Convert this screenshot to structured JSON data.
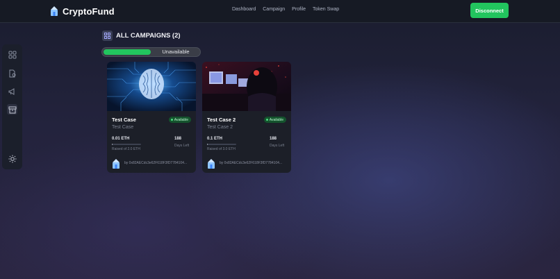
{
  "header": {
    "brand": "CryptoFund",
    "nav": [
      "Dashboard",
      "Campaign",
      "Profile",
      "Token Swap"
    ],
    "disconnect_label": "Disconnect",
    "accent_color": "#22c55e"
  },
  "sidebar": {
    "items": [
      {
        "icon": "grid-icon"
      },
      {
        "icon": "document-icon"
      },
      {
        "icon": "megaphone-icon"
      },
      {
        "icon": "archive-icon"
      },
      {
        "icon": "sun-icon"
      }
    ]
  },
  "main": {
    "title": "ALL CAMPAIGNS (2)",
    "toggle": {
      "unavailable_label": "Unavailable",
      "active": "available"
    },
    "campaigns": [
      {
        "title": "Test Case",
        "subtitle": "Test Case",
        "status": "Available",
        "amount": "0.01 ETH",
        "raised": "Raised of 2.0 ETH",
        "progress_fraction": 0.005,
        "days": "188",
        "days_label": "Days Left",
        "owner": "by 0x82AECdc3e62F618F3fD7784104..."
      },
      {
        "title": "Test Case 2",
        "subtitle": "Test Case 2",
        "status": "Available",
        "amount": "0.1 ETH",
        "raised": "Raised of 3.0 ETH",
        "progress_fraction": 0.033,
        "days": "188",
        "days_label": "Days Left",
        "owner": "by 0x82AECdc3e62F618F3fD7784104..."
      }
    ]
  }
}
